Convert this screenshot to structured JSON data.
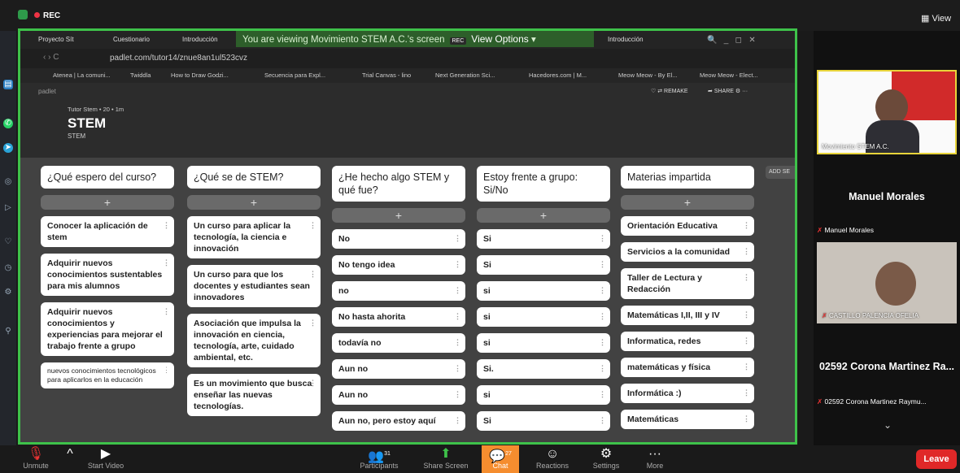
{
  "zoom_top": {
    "rec": "REC",
    "view": "View"
  },
  "browser": {
    "tabs": [
      "Proyecto Sít",
      "Cuestionario",
      "Introducción",
      "Introducción"
    ],
    "banner": "You are viewing Movimiento STEM A.C.'s screen",
    "banner_tag": "REC",
    "view_options": "View Options",
    "url": "padlet.com/tutor14/znue8an1ul523cvz",
    "bookmarks": [
      "Atenea | La comuni...",
      "Twiddla",
      "How to Draw Godzi...",
      "Secuencia para Expl...",
      "Trial Canvas - lino",
      "Next Generation Sci...",
      "Hacedores.com | M...",
      "Meow Meow - By El...",
      "Meow Meow - Elect..."
    ]
  },
  "padlet": {
    "brand": "padlet",
    "author": "Tutor Stem • 20 • 1m",
    "title": "STEM",
    "subtitle": "STEM",
    "remake": "REMAKE",
    "share": "SHARE",
    "add_section": "ADD SE",
    "columns": [
      {
        "title": "¿Qué espero del curso?",
        "cards": [
          "Conocer la aplicación de stem",
          "Adquirir nuevos conocimientos sustentables para mis alumnos",
          "Adquirir nuevos conocimientos y experiencias para mejorar el trabajo frente a grupo",
          "nuevos conocimientos tecnológicos para aplicarlos en la educación"
        ]
      },
      {
        "title": "¿Qué se de STEM?",
        "cards": [
          "Un curso para aplicar la tecnología, la ciencia e innovación",
          "Un curso para que los docentes y estudiantes sean innovadores",
          "Asociación que impulsa la innovación en ciencia, tecnología, arte, cuidado ambiental, etc.",
          "Es un movimiento que busca enseñar las nuevas tecnologías."
        ]
      },
      {
        "title": "¿He hecho algo STEM y qué fue?",
        "cards": [
          "No",
          "No tengo idea",
          "no",
          "No hasta ahorita",
          "todavía no",
          "Aun no",
          "Aun no",
          "Aun no, pero estoy aquí"
        ]
      },
      {
        "title": "Estoy frente a grupo: Si/No",
        "cards": [
          "Si",
          "Si",
          "si",
          "si",
          "si",
          "Si.",
          "si",
          "Si"
        ]
      },
      {
        "title": "Materias impartida",
        "cards": [
          "Orientación Educativa",
          "Servicios a la comunidad",
          "Taller de Lectura y Redacción",
          "Matemáticas I,II, III y IV",
          "Informatica, redes",
          "matemáticas y física",
          "Informática :)",
          "Matemáticas"
        ]
      }
    ]
  },
  "participants": {
    "host": "Movimiento STEM A.C.",
    "p2_big": "Manuel Morales",
    "p2": "Manuel Morales",
    "p3": "CASTILLO PALENCIA OFELIA",
    "p4_big": "02592 Corona Martinez Ra...",
    "p4": "02592 Corona Martinez Raymu..."
  },
  "toolbar": {
    "unmute": "Unmute",
    "video": "Start Video",
    "participants": "Participants",
    "participants_count": "31",
    "share": "Share Screen",
    "chat": "Chat",
    "chat_count": "27",
    "reactions": "Reactions",
    "settings": "Settings",
    "more": "More",
    "leave": "Leave"
  }
}
